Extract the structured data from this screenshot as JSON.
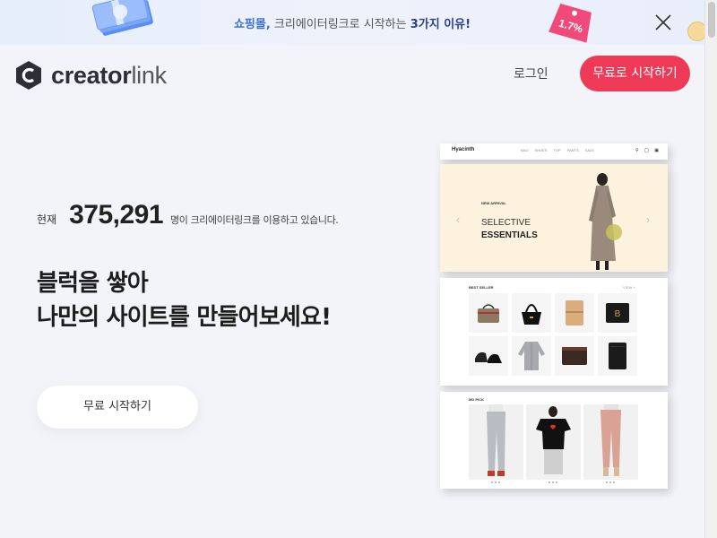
{
  "promo": {
    "highlight": "쇼핑몰,",
    "middle": " 크리에이터링크로 시작하는 ",
    "emphasis": "3가지 이유!",
    "tag_text": "1.7%"
  },
  "header": {
    "logo_bold": "creator",
    "logo_light": "link",
    "login_label": "로그인",
    "start_label": "무료로 시작하기"
  },
  "hero": {
    "stats_prefix": "현재",
    "user_count": "375,291",
    "stats_suffix": "명이 크리에이터링크를 이용하고 있습니다.",
    "headline_line1": "블럭을 쌓아",
    "headline_line2": "나만의 사이트를 만들어보세요!",
    "cta_label": "무료 시작하기"
  },
  "mockup": {
    "brand": "Hyacinth",
    "menu": [
      "BAG",
      "SHOES",
      "TOP",
      "PANTS",
      "SALE"
    ],
    "new_arrival": "NEW ARRIVAL",
    "slide_line1": "SELECTIVE",
    "slide_line2": "ESSENTIALS",
    "best_seller": "BEST SELLER",
    "more": "VIEW +",
    "md_pick": "MD PICK"
  },
  "colors": {
    "brand_red": "#ee3a56",
    "promo_blue": "#3b6fd8",
    "page_bg": "#f3f4f9"
  },
  "icons": [
    "money-stack-icon",
    "price-tag-icon",
    "close-icon",
    "creatorlink-logo-icon",
    "search-icon",
    "user-icon",
    "cart-icon"
  ]
}
